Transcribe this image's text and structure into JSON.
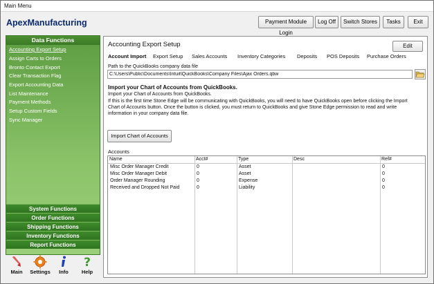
{
  "window": {
    "title": "Main Menu"
  },
  "app": {
    "title": "ApexManufacturing"
  },
  "toolbar": {
    "payment_module_login": "Payment Module Login",
    "log_off": "Log Off",
    "switch_stores": "Switch Stores",
    "tasks": "Tasks",
    "exit": "Exit"
  },
  "sidebar": {
    "header": "Data Functions",
    "items": [
      {
        "label": "Accounting Export Setup",
        "active": true
      },
      {
        "label": "Assign Carts to Orders"
      },
      {
        "label": "Bronto Contact Export"
      },
      {
        "label": "Clear Transaction Flag"
      },
      {
        "label": "Export Accounting Data"
      },
      {
        "label": "List Maintenance"
      },
      {
        "label": "Payment Methods"
      },
      {
        "label": "Setup Custom Fields"
      },
      {
        "label": "Sync Manager"
      }
    ],
    "functions": [
      "System Functions",
      "Order Functions",
      "Shipping Functions",
      "Inventory Functions",
      "Report Functions"
    ]
  },
  "bottom_icons": [
    {
      "label": "Main",
      "icon": "main-arrow-icon"
    },
    {
      "label": "Settings",
      "icon": "gear-icon"
    },
    {
      "label": "Info",
      "icon": "info-icon"
    },
    {
      "label": "Help",
      "icon": "question-icon"
    }
  ],
  "main": {
    "title": "Accounting Export Setup",
    "edit_label": "Edit",
    "tabs": [
      "Account Import",
      "Export Setup",
      "Sales Accounts",
      "Inventory Categories",
      "Deposits",
      "POS Deposits",
      "Purchase Orders"
    ],
    "path_label": "Path to the QuickBooks company data file",
    "path_value": "C:\\Users\\Public\\Documents\\Intuit\\QuickBooks\\Company Files\\Ajax Orders.qbw",
    "import_heading": "Import your Chart of Accounts from QuickBooks.",
    "import_text1": "Import your Chart of Accounts from QuickBooks.",
    "import_text2": "If this is the first time Stone Edge will be communicating with QuickBooks, you will need to have QuickBooks open before clicking the Import Chart of Accounts button. Once the button is clicked, you must return to QuickBooks and give Stone Edge permission to read and write information in your company data file.",
    "import_button": "Import Chart of Accounts",
    "accounts_label": "Accounts",
    "accounts_columns": [
      "Name",
      "Acct#",
      "Type",
      "Desc",
      "Ref#"
    ],
    "accounts_rows": [
      [
        "Misc Order Manager Credit",
        "0",
        "Asset",
        "",
        "0"
      ],
      [
        "Misc Order Manager Debit",
        "0",
        "Asset",
        "",
        "0"
      ],
      [
        "Order Manager Rounding",
        "0",
        "Expense",
        "",
        "0"
      ],
      [
        "Received and Dropped Not Paid",
        "0",
        "Liability",
        "",
        "0"
      ]
    ]
  },
  "colors": {
    "sidebar_green": "#5e9d42",
    "function_green": "#2f7420",
    "title_blue": "#0b2a6e"
  }
}
